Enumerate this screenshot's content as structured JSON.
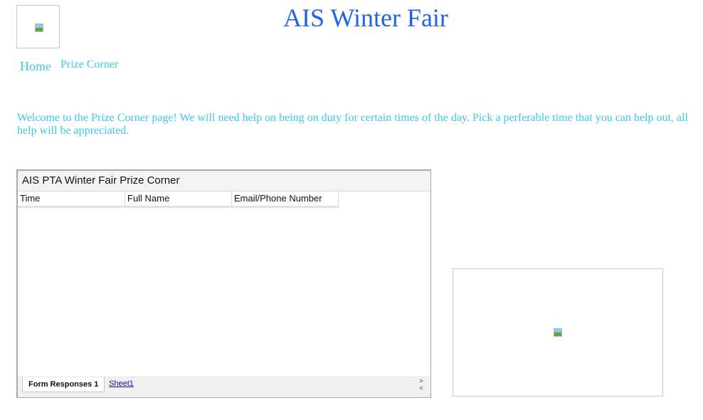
{
  "header": {
    "title": "AIS Winter Fair",
    "logo_icon": "broken-image-icon"
  },
  "nav": {
    "home_label": "Home",
    "prize_label": "Prize Corner"
  },
  "main": {
    "welcome_text": "Welcome to the Prize Corner page! We will need help on being on duty for certain times of the day. Pick a perferable time that you can help out, all help will be appreciated."
  },
  "sheet": {
    "title": "AIS PTA Winter Fair Prize Corner",
    "columns": [
      "Time",
      "Full Name",
      "Email/Phone Number"
    ],
    "tabs": {
      "active": "Form Responses 1",
      "other": "Sheet1"
    },
    "scroll_right_icon": ">",
    "scroll_left_icon": "<"
  },
  "side_image": {
    "icon": "broken-image-icon"
  },
  "colors": {
    "title": "#1f63e6",
    "accent": "#3bc8e8",
    "link": "#1a0dab"
  }
}
